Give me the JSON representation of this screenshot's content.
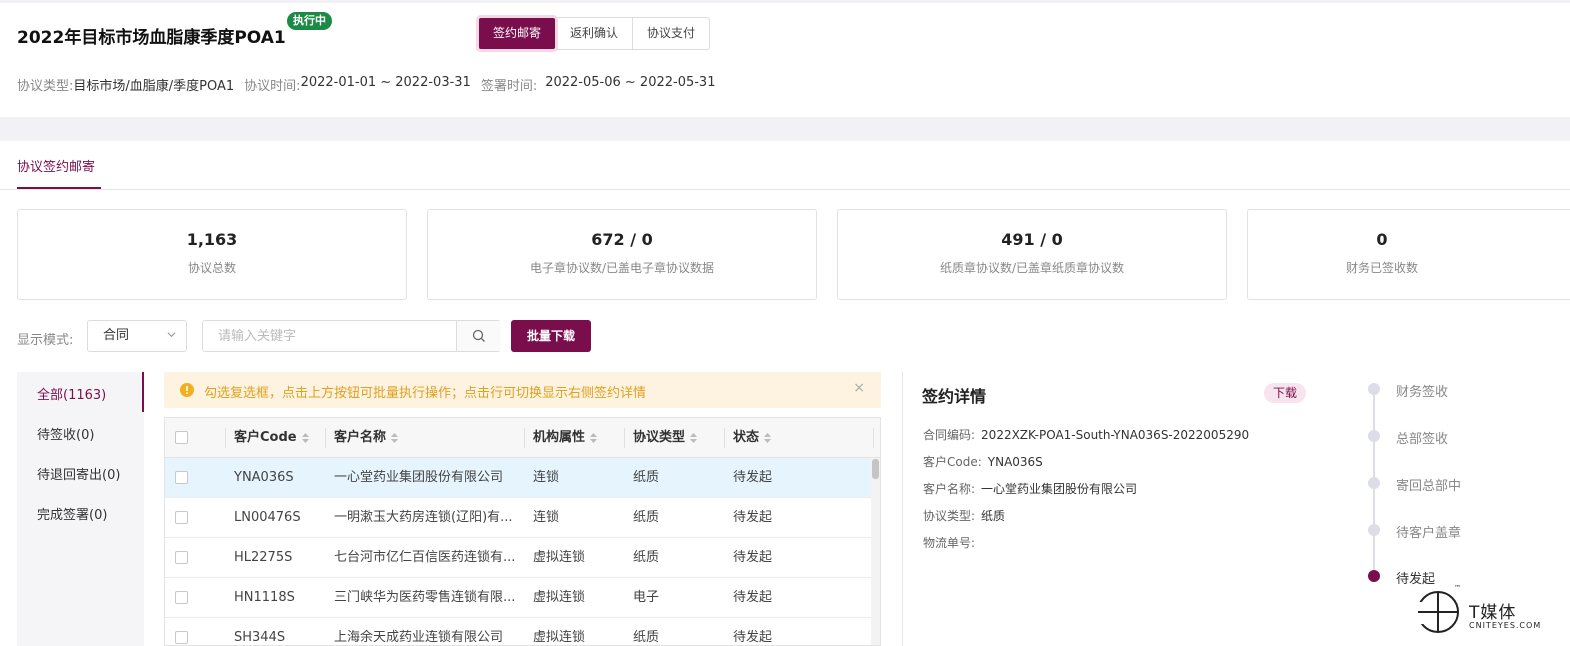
{
  "header": {
    "title": "2022年目标市场血脂康季度POA1",
    "status": "执行中",
    "tabs": [
      {
        "label": "签约邮寄",
        "active": true
      },
      {
        "label": "返利确认",
        "active": false
      },
      {
        "label": "协议支付",
        "active": false
      }
    ],
    "meta": {
      "type_label": "协议类型:",
      "type_value": "目标市场/血脂康/季度POA1",
      "period_label": "协议时间:",
      "period_value": "2022-01-01 ~ 2022-03-31",
      "sign_label": "签署时间:",
      "sign_value": "2022-05-06 ~ 2022-05-31"
    }
  },
  "subtab": {
    "label": "协议签约邮寄"
  },
  "stats": [
    {
      "value": "1,163",
      "label": "协议总数"
    },
    {
      "value": "672 / 0",
      "label": "电子章协议数/已盖电子章协议数据"
    },
    {
      "value": "491 / 0",
      "label": "纸质章协议数/已盖章纸质章协议数"
    },
    {
      "value": "0",
      "label": "财务已签收数"
    }
  ],
  "filters": {
    "mode_label": "显示模式:",
    "mode_value": "合同",
    "search_placeholder": "请输入关键字",
    "batch_label": "批量下载"
  },
  "sidebar": {
    "items": [
      {
        "label": "全部(1163)",
        "active": true
      },
      {
        "label": "待签收(0)",
        "active": false
      },
      {
        "label": "待退回寄出(0)",
        "active": false
      },
      {
        "label": "完成签署(0)",
        "active": false
      }
    ]
  },
  "alert": {
    "text": "勾选复选框，点击上方按钮可批量执行操作；点击行可切换显示右侧签约详情",
    "close": "×"
  },
  "table": {
    "columns": [
      "客户Code",
      "客户名称",
      "机构属性",
      "协议类型",
      "状态"
    ],
    "rows": [
      [
        "YNA036S",
        "一心堂药业集团股份有限公司",
        "连锁",
        "纸质",
        "待发起"
      ],
      [
        "LN00476S",
        "一明漱玉大药房连锁(辽阳)有...",
        "连锁",
        "纸质",
        "待发起"
      ],
      [
        "HL2275S",
        "七台河市亿仁百信医药连锁有...",
        "虚拟连锁",
        "纸质",
        "待发起"
      ],
      [
        "HN1118S",
        "三门峡华为医药零售连锁有限...",
        "虚拟连锁",
        "电子",
        "待发起"
      ],
      [
        "SH344S",
        "上海余天成药业连锁有限公司",
        "虚拟连锁",
        "纸质",
        "待发起"
      ]
    ]
  },
  "detail": {
    "title": "签约详情",
    "download": "下载",
    "fields": [
      {
        "k": "合同编码:",
        "v": "2022XZK-POA1-South-YNA036S-2022005290"
      },
      {
        "k": "客户Code:",
        "v": "YNA036S"
      },
      {
        "k": "客户名称:",
        "v": "一心堂药业集团股份有限公司"
      },
      {
        "k": "协议类型:",
        "v": "纸质"
      },
      {
        "k": "物流单号:",
        "v": ""
      }
    ]
  },
  "timeline": {
    "steps": [
      {
        "label": "财务签收",
        "active": false
      },
      {
        "label": "总部签收",
        "active": false
      },
      {
        "label": "寄回总部中",
        "active": false
      },
      {
        "label": "待客户盖章",
        "active": false
      },
      {
        "label": "待发起",
        "active": true
      }
    ]
  },
  "watermark": {
    "text": "T媒体",
    "sub": "CNITEYES.COM",
    "tm": "™"
  },
  "colors": {
    "accent": "#7a0e4c",
    "status_green": "#1a8a44",
    "alert_text": "#e0a020",
    "row_selected": "#e6f5fd"
  }
}
